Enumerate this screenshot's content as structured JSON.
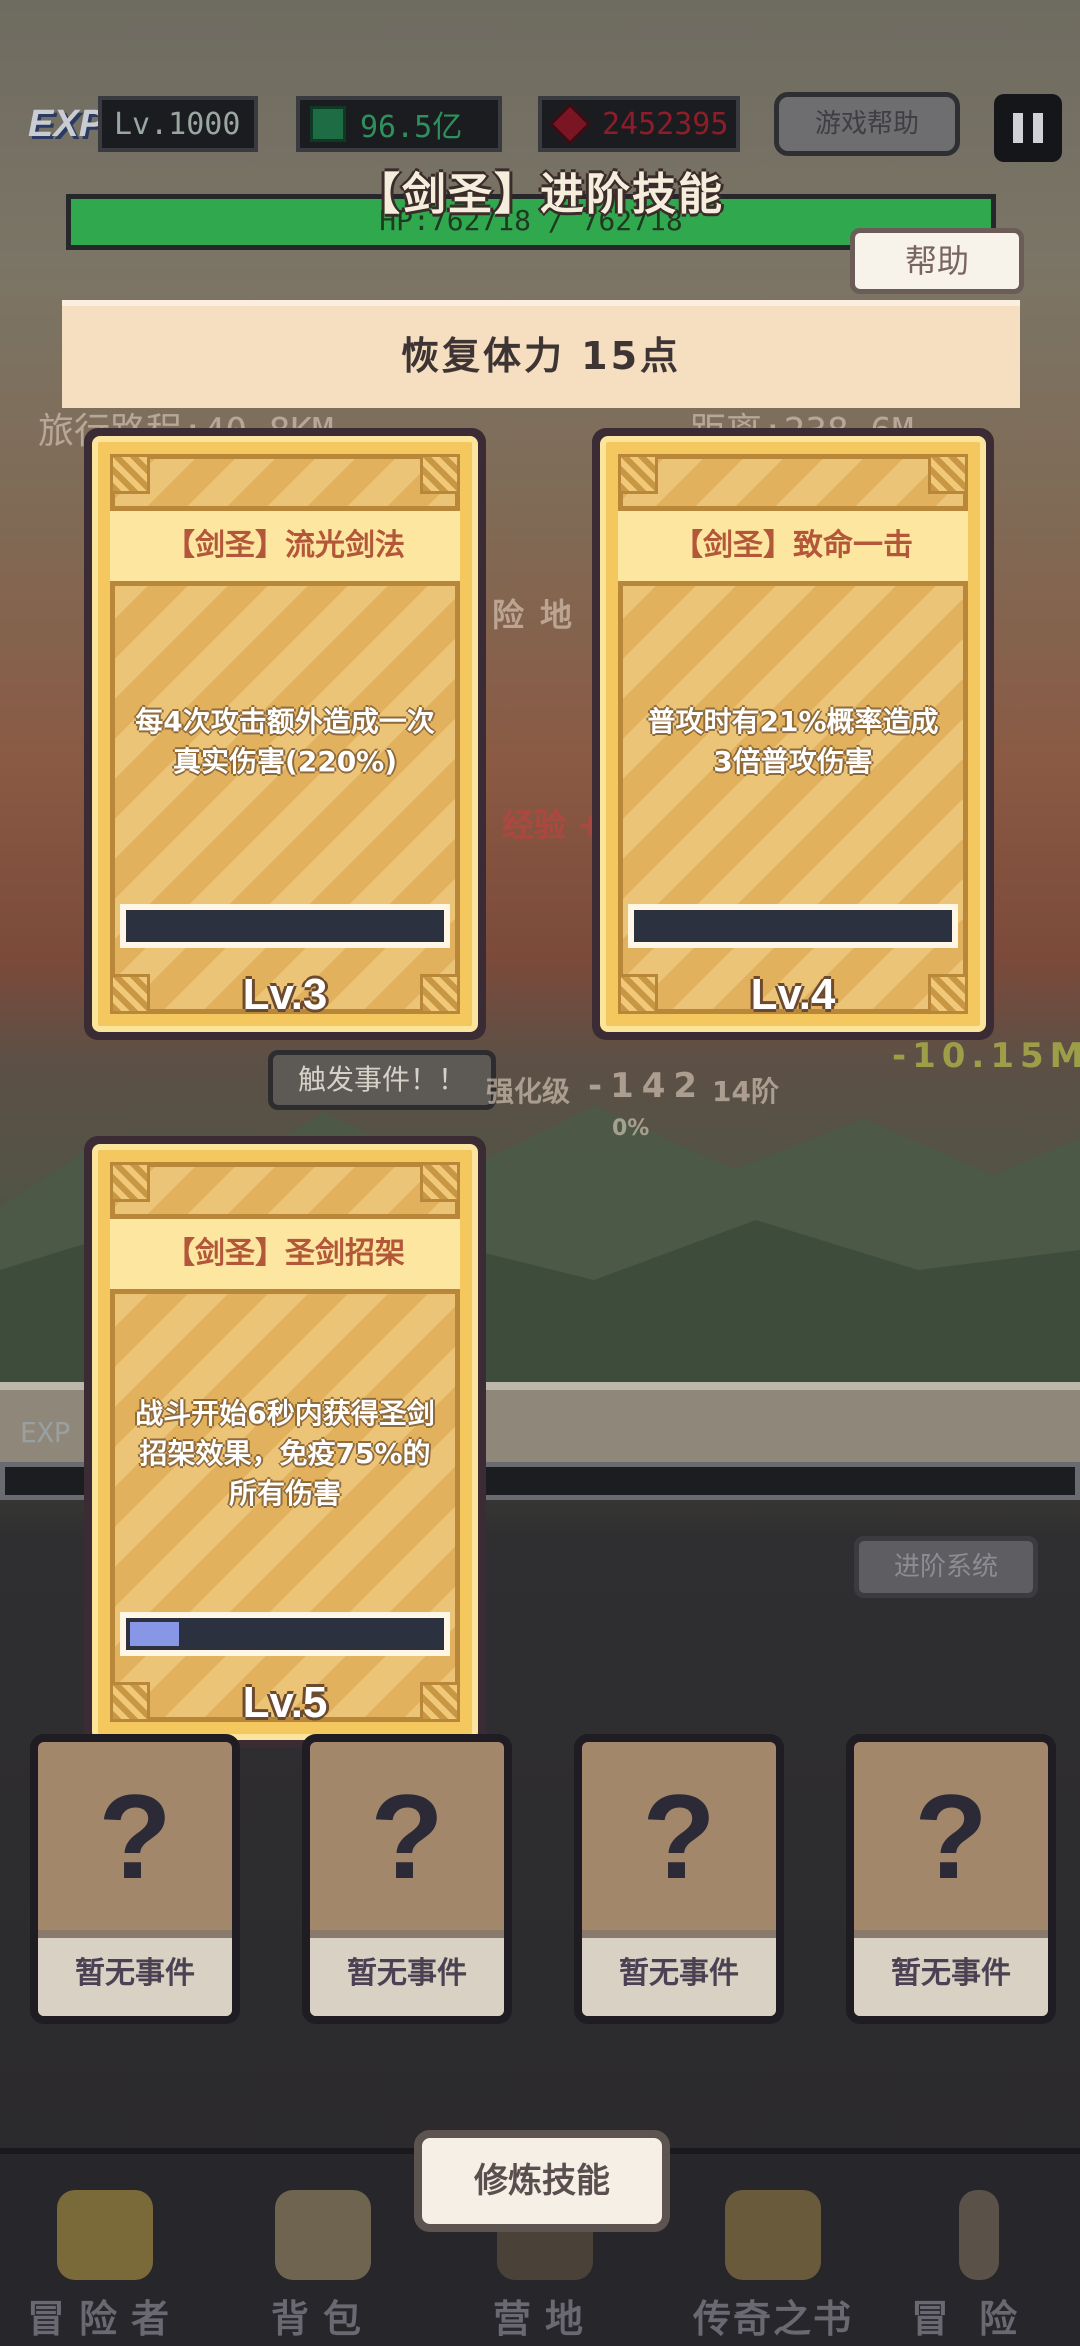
{
  "hud": {
    "exp_badge": "EXP",
    "level": "Lv.1000",
    "gems": "96.5亿",
    "rubies": "2452395",
    "game_help": "游戏帮助"
  },
  "modal": {
    "title": "【剑圣】进阶技能",
    "hp": "HP:762718 / 762718",
    "hp_fraction": 1.0,
    "help": "帮助",
    "restore": "恢复体力 15点"
  },
  "scene": {
    "travel_left": "旅行路程:40.8KM",
    "travel_right": "距离:238.6M",
    "adventure_land": "险地",
    "exp_plus": "经验 +",
    "trigger": "触发事件！！",
    "enhance": "强化级",
    "enhance_value": "-142",
    "stage": "14阶",
    "percent": "0%",
    "distance_right": "-10.15M",
    "exp_label": "EXP",
    "advance_system": "进阶系统"
  },
  "cards": [
    {
      "name": "【剑圣】流光剑法",
      "desc": "每4次攻击额外造成一次真实伤害(220%)",
      "level": "Lv.3",
      "progress": 0
    },
    {
      "name": "【剑圣】致命一击",
      "desc": "普攻时有21%概率造成3倍普攻伤害",
      "level": "Lv.4",
      "progress": 0
    },
    {
      "name": "【剑圣】圣剑招架",
      "desc": "战斗开始6秒内获得圣剑招架效果，免疫75%的所有伤害",
      "level": "Lv.5",
      "progress": 0.18
    }
  ],
  "events": [
    {
      "symbol": "?",
      "label": "暂无事件"
    },
    {
      "symbol": "?",
      "label": "暂无事件"
    },
    {
      "symbol": "?",
      "label": "暂无事件"
    },
    {
      "symbol": "?",
      "label": "暂无事件"
    }
  ],
  "nav": {
    "items": [
      {
        "label": "冒险者",
        "icon": "helmet-icon"
      },
      {
        "label": "背包",
        "icon": "backpack-icon"
      },
      {
        "label": "营地",
        "icon": "camp-icon"
      },
      {
        "label": "传奇之书",
        "icon": "book-icon"
      },
      {
        "label": "冒险",
        "icon": "sword-icon"
      }
    ],
    "train": "修炼技能"
  },
  "colors": {
    "card_gold": "#f4c75f",
    "card_name_text": "#b3573a",
    "hp_green": "#2fa84e",
    "progress_fill": "#8896e6"
  }
}
